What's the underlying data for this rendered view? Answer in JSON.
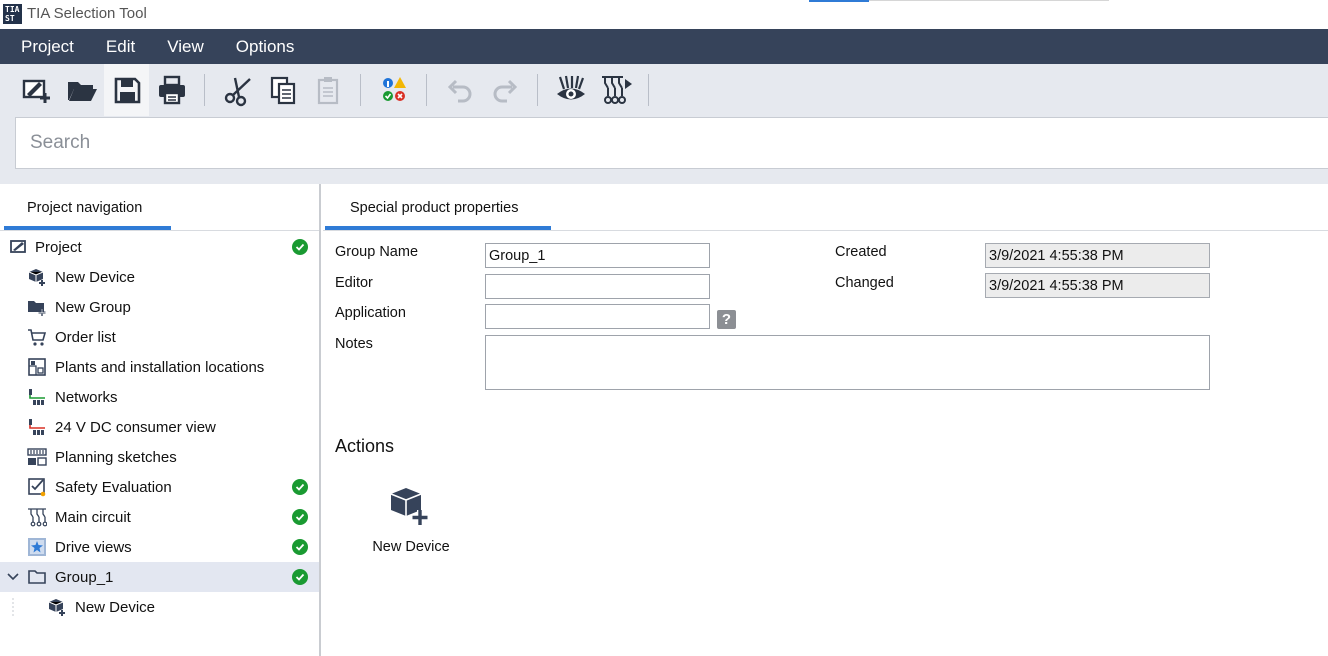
{
  "app": {
    "logo_text": "TIA ST",
    "title": "TIA Selection Tool"
  },
  "menu": [
    "Project",
    "Edit",
    "View",
    "Options"
  ],
  "toolbar": {
    "buttons": [
      {
        "icon": "new-project-icon",
        "enabled": true
      },
      {
        "icon": "open-folder-icon",
        "enabled": true
      },
      {
        "icon": "save-icon",
        "enabled": true,
        "active": true
      },
      {
        "icon": "print-icon",
        "enabled": true
      },
      {
        "icon": "cut-icon",
        "enabled": true
      },
      {
        "icon": "copy-icon",
        "enabled": true
      },
      {
        "icon": "paste-icon",
        "enabled": false
      },
      {
        "icon": "check-status-icon",
        "enabled": true
      },
      {
        "icon": "undo-icon",
        "enabled": false
      },
      {
        "icon": "redo-icon",
        "enabled": false
      },
      {
        "icon": "preview-icon",
        "enabled": true
      },
      {
        "icon": "circuit-run-icon",
        "enabled": true
      }
    ]
  },
  "search": {
    "placeholder": "Search",
    "value": ""
  },
  "navigation": {
    "tab_label": "Project navigation",
    "items": [
      {
        "label": "Project",
        "icon": "project-icon",
        "level": 0,
        "ok": true
      },
      {
        "label": "New Device",
        "icon": "new-device-icon",
        "level": 1,
        "ok": false
      },
      {
        "label": "New Group",
        "icon": "new-group-icon",
        "level": 1,
        "ok": false
      },
      {
        "label": "Order list",
        "icon": "cart-icon",
        "level": 1,
        "ok": false
      },
      {
        "label": "Plants and installation locations",
        "icon": "plant-icon",
        "level": 1,
        "ok": false
      },
      {
        "label": "Networks",
        "icon": "network-icon",
        "level": 1,
        "ok": false
      },
      {
        "label": "24 V DC consumer view",
        "icon": "consumer-view-icon",
        "level": 1,
        "ok": false
      },
      {
        "label": "Planning sketches",
        "icon": "sketch-icon",
        "level": 1,
        "ok": false
      },
      {
        "label": "Safety Evaluation",
        "icon": "safety-icon",
        "level": 1,
        "ok": true
      },
      {
        "label": "Main circuit",
        "icon": "circuit-icon",
        "level": 1,
        "ok": true
      },
      {
        "label": "Drive views",
        "icon": "drive-icon",
        "level": 1,
        "ok": true
      },
      {
        "label": "Group_1",
        "icon": "folder-icon",
        "level": 1,
        "ok": true,
        "selected": true,
        "expanded": true
      },
      {
        "label": "New Device",
        "icon": "new-device-icon",
        "level": 2,
        "ok": false
      }
    ]
  },
  "properties": {
    "tab_label": "Special product properties",
    "group_name_label": "Group Name",
    "group_name_value": "Group_1",
    "editor_label": "Editor",
    "editor_value": "",
    "application_label": "Application",
    "application_value": "",
    "help_glyph": "?",
    "notes_label": "Notes",
    "notes_value": "",
    "created_label": "Created",
    "created_value": "3/9/2021 4:55:38 PM",
    "changed_label": "Changed",
    "changed_value": "3/9/2021 4:55:38 PM"
  },
  "actions": {
    "title": "Actions",
    "items": [
      {
        "label": "New Device",
        "icon": "new-device-icon"
      }
    ]
  },
  "colors": {
    "menubar": "#36435a",
    "accent": "#2f7bd6",
    "ok_green": "#1a9a32",
    "toolbar_bg": "#e6e9ef",
    "selected_row": "#e3e7f1"
  }
}
